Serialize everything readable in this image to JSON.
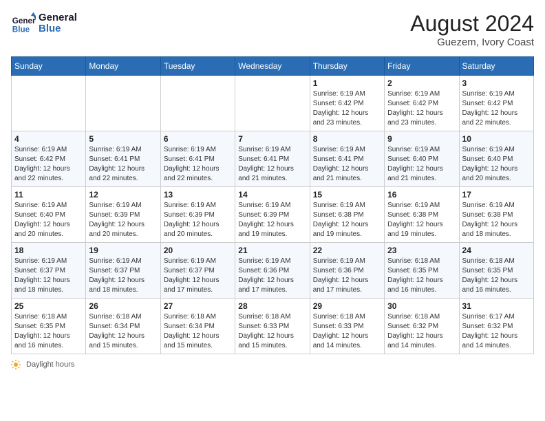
{
  "header": {
    "logo_line1": "General",
    "logo_line2": "Blue",
    "month_year": "August 2024",
    "location": "Guezem, Ivory Coast"
  },
  "weekdays": [
    "Sunday",
    "Monday",
    "Tuesday",
    "Wednesday",
    "Thursday",
    "Friday",
    "Saturday"
  ],
  "weeks": [
    [
      {
        "day": "",
        "info": ""
      },
      {
        "day": "",
        "info": ""
      },
      {
        "day": "",
        "info": ""
      },
      {
        "day": "",
        "info": ""
      },
      {
        "day": "1",
        "info": "Sunrise: 6:19 AM\nSunset: 6:42 PM\nDaylight: 12 hours\nand 23 minutes."
      },
      {
        "day": "2",
        "info": "Sunrise: 6:19 AM\nSunset: 6:42 PM\nDaylight: 12 hours\nand 23 minutes."
      },
      {
        "day": "3",
        "info": "Sunrise: 6:19 AM\nSunset: 6:42 PM\nDaylight: 12 hours\nand 22 minutes."
      }
    ],
    [
      {
        "day": "4",
        "info": "Sunrise: 6:19 AM\nSunset: 6:42 PM\nDaylight: 12 hours\nand 22 minutes."
      },
      {
        "day": "5",
        "info": "Sunrise: 6:19 AM\nSunset: 6:41 PM\nDaylight: 12 hours\nand 22 minutes."
      },
      {
        "day": "6",
        "info": "Sunrise: 6:19 AM\nSunset: 6:41 PM\nDaylight: 12 hours\nand 22 minutes."
      },
      {
        "day": "7",
        "info": "Sunrise: 6:19 AM\nSunset: 6:41 PM\nDaylight: 12 hours\nand 21 minutes."
      },
      {
        "day": "8",
        "info": "Sunrise: 6:19 AM\nSunset: 6:41 PM\nDaylight: 12 hours\nand 21 minutes."
      },
      {
        "day": "9",
        "info": "Sunrise: 6:19 AM\nSunset: 6:40 PM\nDaylight: 12 hours\nand 21 minutes."
      },
      {
        "day": "10",
        "info": "Sunrise: 6:19 AM\nSunset: 6:40 PM\nDaylight: 12 hours\nand 20 minutes."
      }
    ],
    [
      {
        "day": "11",
        "info": "Sunrise: 6:19 AM\nSunset: 6:40 PM\nDaylight: 12 hours\nand 20 minutes."
      },
      {
        "day": "12",
        "info": "Sunrise: 6:19 AM\nSunset: 6:39 PM\nDaylight: 12 hours\nand 20 minutes."
      },
      {
        "day": "13",
        "info": "Sunrise: 6:19 AM\nSunset: 6:39 PM\nDaylight: 12 hours\nand 20 minutes."
      },
      {
        "day": "14",
        "info": "Sunrise: 6:19 AM\nSunset: 6:39 PM\nDaylight: 12 hours\nand 19 minutes."
      },
      {
        "day": "15",
        "info": "Sunrise: 6:19 AM\nSunset: 6:38 PM\nDaylight: 12 hours\nand 19 minutes."
      },
      {
        "day": "16",
        "info": "Sunrise: 6:19 AM\nSunset: 6:38 PM\nDaylight: 12 hours\nand 19 minutes."
      },
      {
        "day": "17",
        "info": "Sunrise: 6:19 AM\nSunset: 6:38 PM\nDaylight: 12 hours\nand 18 minutes."
      }
    ],
    [
      {
        "day": "18",
        "info": "Sunrise: 6:19 AM\nSunset: 6:37 PM\nDaylight: 12 hours\nand 18 minutes."
      },
      {
        "day": "19",
        "info": "Sunrise: 6:19 AM\nSunset: 6:37 PM\nDaylight: 12 hours\nand 18 minutes."
      },
      {
        "day": "20",
        "info": "Sunrise: 6:19 AM\nSunset: 6:37 PM\nDaylight: 12 hours\nand 17 minutes."
      },
      {
        "day": "21",
        "info": "Sunrise: 6:19 AM\nSunset: 6:36 PM\nDaylight: 12 hours\nand 17 minutes."
      },
      {
        "day": "22",
        "info": "Sunrise: 6:19 AM\nSunset: 6:36 PM\nDaylight: 12 hours\nand 17 minutes."
      },
      {
        "day": "23",
        "info": "Sunrise: 6:18 AM\nSunset: 6:35 PM\nDaylight: 12 hours\nand 16 minutes."
      },
      {
        "day": "24",
        "info": "Sunrise: 6:18 AM\nSunset: 6:35 PM\nDaylight: 12 hours\nand 16 minutes."
      }
    ],
    [
      {
        "day": "25",
        "info": "Sunrise: 6:18 AM\nSunset: 6:35 PM\nDaylight: 12 hours\nand 16 minutes."
      },
      {
        "day": "26",
        "info": "Sunrise: 6:18 AM\nSunset: 6:34 PM\nDaylight: 12 hours\nand 15 minutes."
      },
      {
        "day": "27",
        "info": "Sunrise: 6:18 AM\nSunset: 6:34 PM\nDaylight: 12 hours\nand 15 minutes."
      },
      {
        "day": "28",
        "info": "Sunrise: 6:18 AM\nSunset: 6:33 PM\nDaylight: 12 hours\nand 15 minutes."
      },
      {
        "day": "29",
        "info": "Sunrise: 6:18 AM\nSunset: 6:33 PM\nDaylight: 12 hours\nand 14 minutes."
      },
      {
        "day": "30",
        "info": "Sunrise: 6:18 AM\nSunset: 6:32 PM\nDaylight: 12 hours\nand 14 minutes."
      },
      {
        "day": "31",
        "info": "Sunrise: 6:17 AM\nSunset: 6:32 PM\nDaylight: 12 hours\nand 14 minutes."
      }
    ]
  ],
  "footer": {
    "daylight_label": "Daylight hours"
  }
}
